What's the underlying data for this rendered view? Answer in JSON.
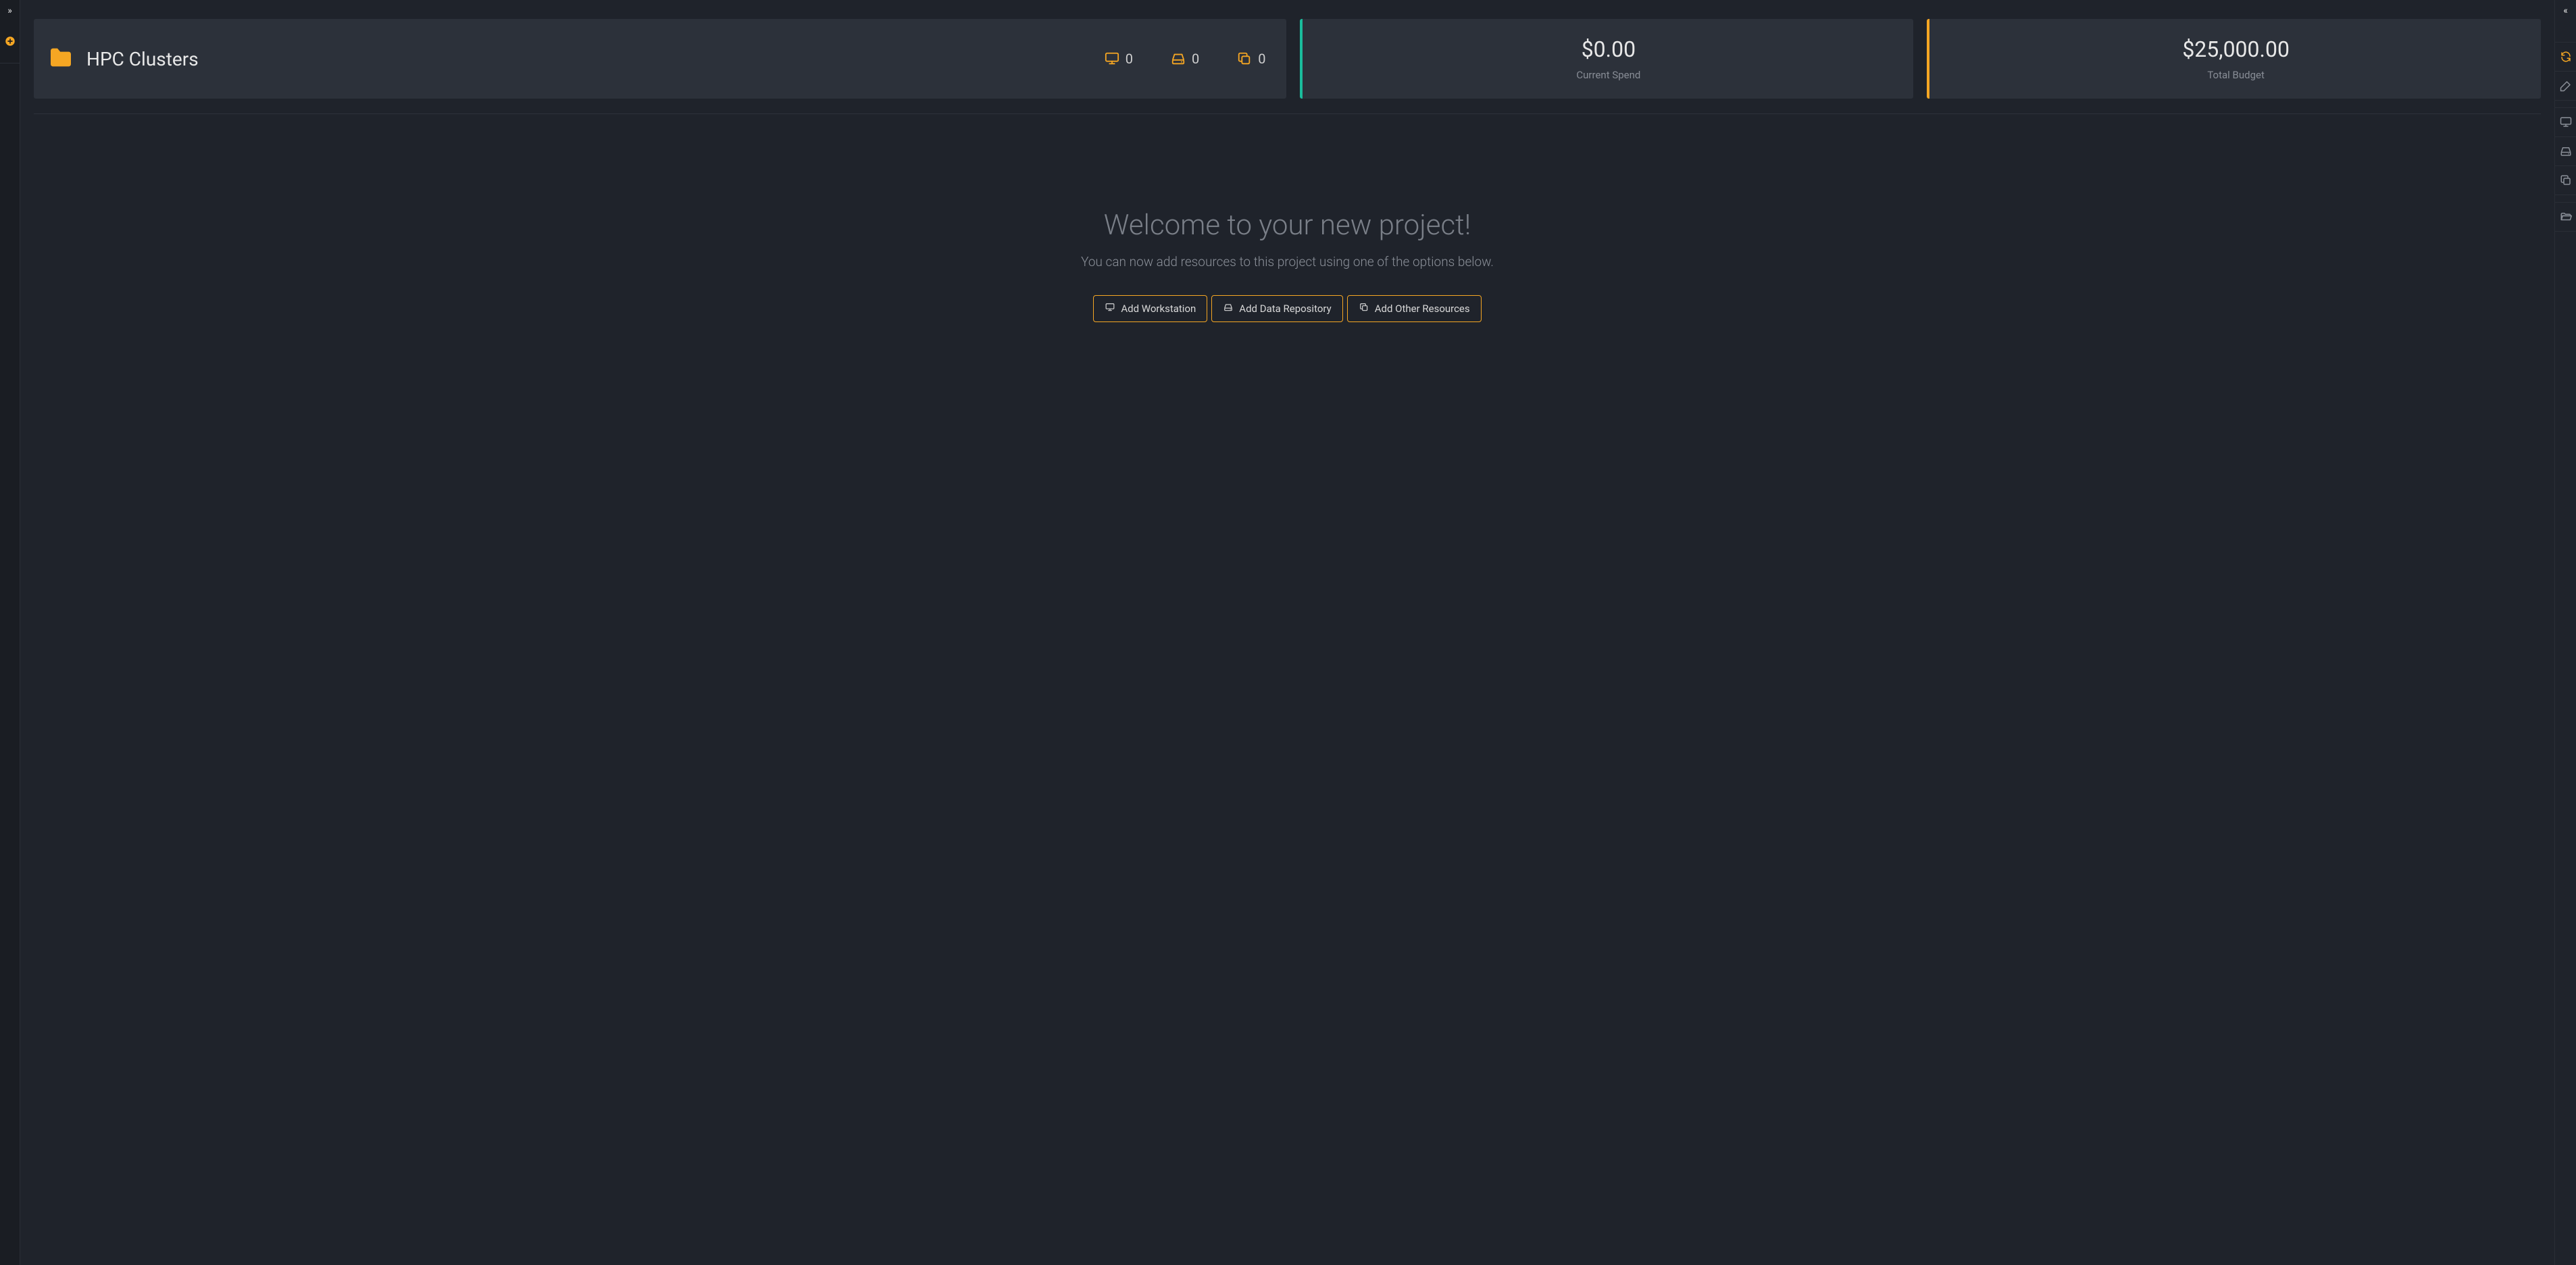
{
  "left_sidebar": {
    "expand_icon": "chevrons-right",
    "add_icon": "plus-circle"
  },
  "right_sidebar": {
    "collapse_icon": "chevrons-left",
    "items": [
      {
        "icon": "refresh",
        "accent": true
      },
      {
        "icon": "pencil"
      },
      {
        "icon": "monitor"
      },
      {
        "icon": "drive"
      },
      {
        "icon": "copy"
      },
      {
        "icon": "folder-open"
      }
    ]
  },
  "project": {
    "title": "HPC Clusters",
    "counts": {
      "workstations": "0",
      "repositories": "0",
      "other": "0"
    }
  },
  "spend": {
    "amount": "$0.00",
    "label": "Current Spend",
    "accent": "#1abc9c"
  },
  "budget": {
    "amount": "$25,000.00",
    "label": "Total Budget",
    "accent": "#f5a623"
  },
  "welcome": {
    "heading": "Welcome to your new project!",
    "subheading": "You can now add resources to this project using one of the options below.",
    "buttons": {
      "add_workstation": "Add Workstation",
      "add_data_repository": "Add Data Repository",
      "add_other_resources": "Add Other Resources"
    }
  },
  "colors": {
    "accent_orange": "#f5a623",
    "accent_green": "#1abc9c",
    "card_bg": "#2c313a",
    "page_bg": "#1f232b"
  }
}
